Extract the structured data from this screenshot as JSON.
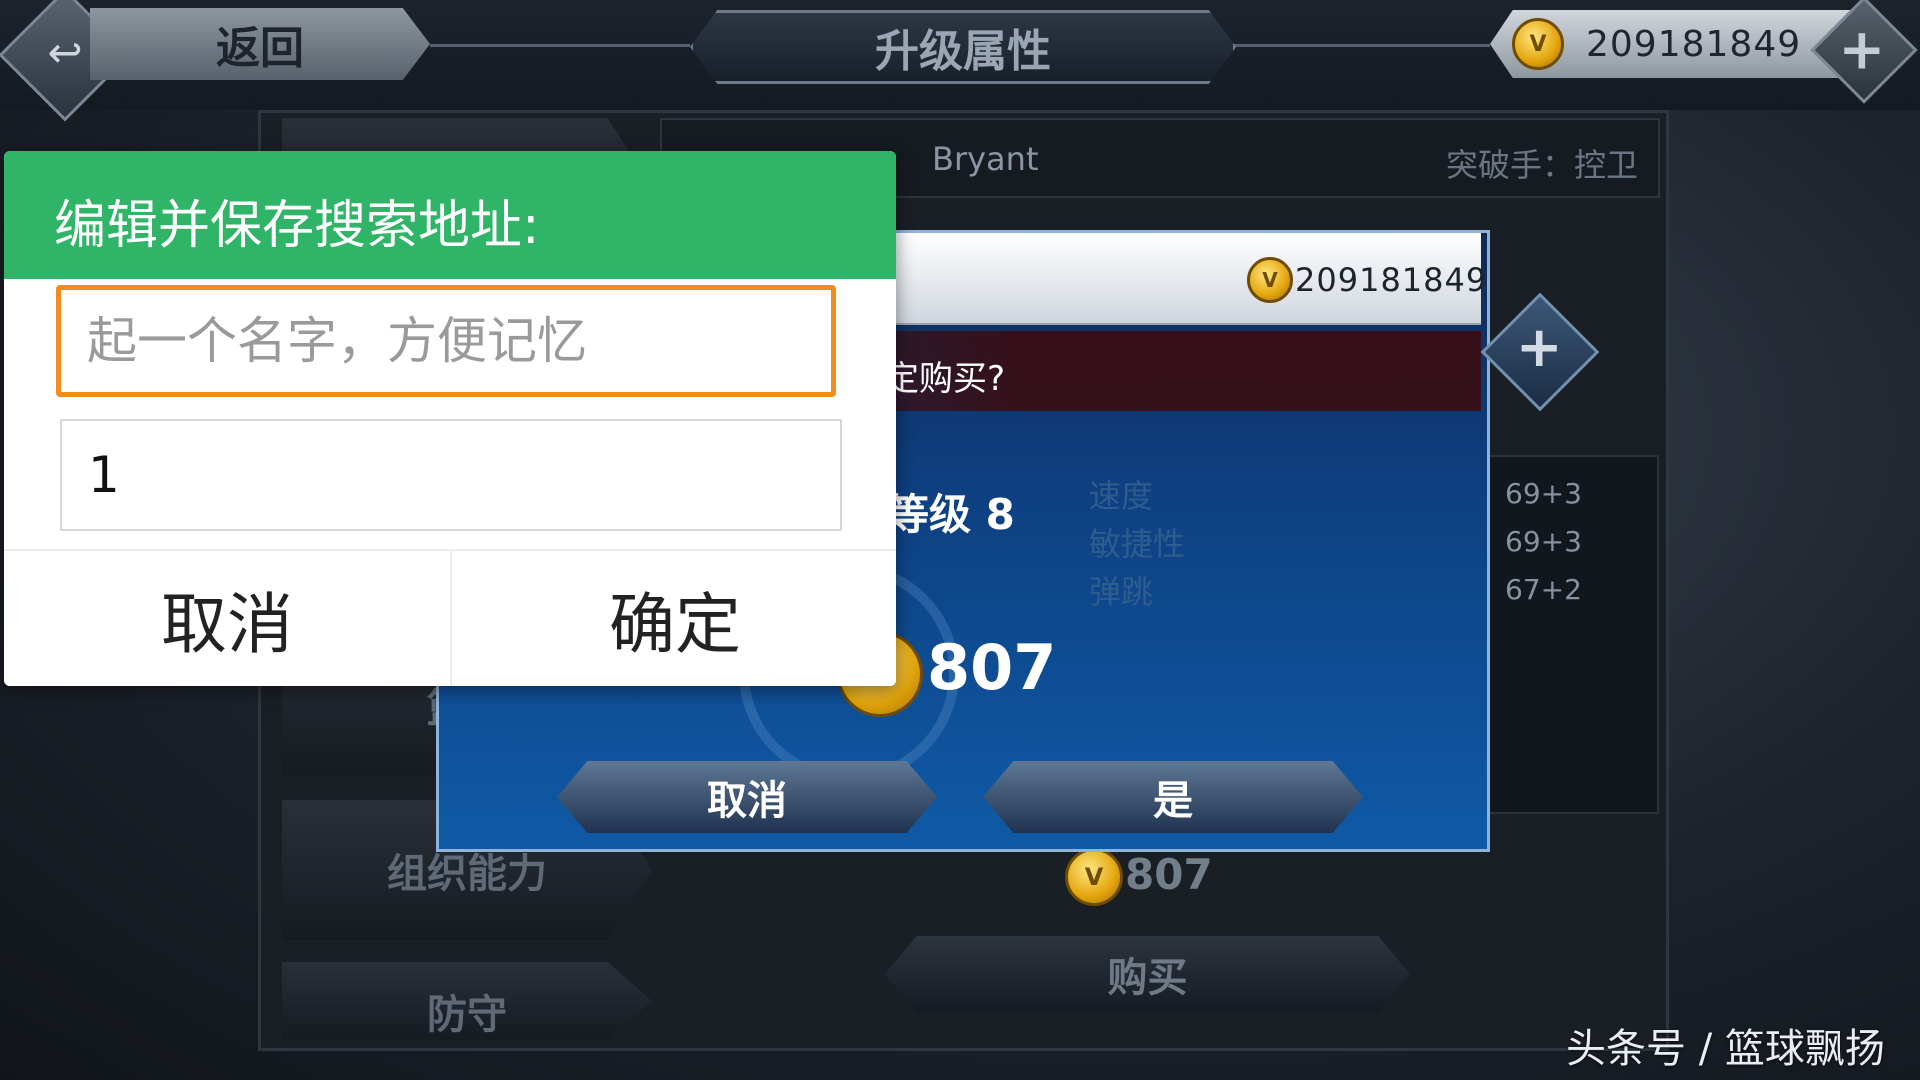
{
  "topbar": {
    "back_label": "返回",
    "title": "升级属性",
    "coin_balance": "209181849"
  },
  "player": {
    "name": "Bryant",
    "role": "突破手：控卫"
  },
  "left_tabs": [
    {
      "label": "篮板"
    },
    {
      "label": "组织能力"
    },
    {
      "label": "防守"
    }
  ],
  "stats": {
    "values": [
      "69+3",
      "69+3",
      "67+2"
    ]
  },
  "buy_panel": {
    "price": "807",
    "buy_label": "购买"
  },
  "confirm_dialog": {
    "coin_balance": "209181849",
    "question": "定购买?",
    "level": "等级 8",
    "attributes": [
      "速度",
      "敏捷性",
      "弹跳"
    ],
    "price": "807",
    "cancel_label": "取消",
    "yes_label": "是"
  },
  "edit_dialog": {
    "title": "编辑并保存搜索地址:",
    "name_placeholder": "起一个名字，方便记忆",
    "address_value": "1",
    "cancel_label": "取消",
    "ok_label": "确定"
  },
  "watermark": "头条号 / 篮球飘扬",
  "colors": {
    "dialog_header_green": "#30b468",
    "active_field_orange": "#f08c1e",
    "confirm_blue": "#0f5aa6",
    "coin_gold": "#e3a50d"
  }
}
